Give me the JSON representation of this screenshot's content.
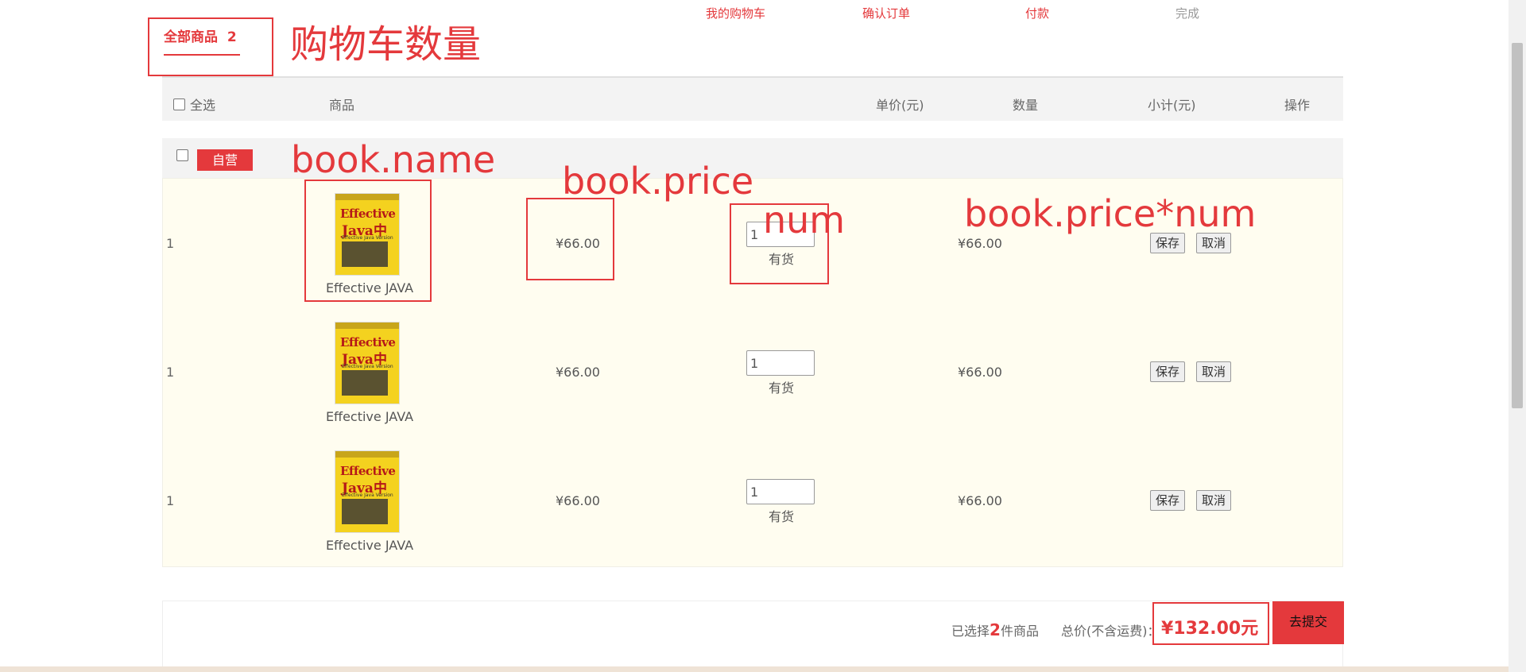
{
  "steps": [
    "我的购物车",
    "确认订单",
    "付款",
    "完成"
  ],
  "tab": {
    "label": "全部商品",
    "count": "2"
  },
  "annotations": {
    "title": "购物车数量",
    "name": "book.name",
    "price": "book.price",
    "num": "num",
    "subtotal": "book.price*num"
  },
  "header": {
    "select_all": "全选",
    "goods": "商品",
    "unit_price": "单价(元)",
    "quantity": "数量",
    "subtotal": "小计(元)",
    "actions": "操作"
  },
  "shop": {
    "tag": "自营"
  },
  "items": [
    {
      "index": "1",
      "name": "Effective JAVA",
      "price": "¥66.00",
      "num": "1",
      "stock": "有货",
      "subtotal": "¥66.00",
      "save": "保存",
      "cancel": "取消"
    },
    {
      "index": "1",
      "name": "Effective JAVA",
      "price": "¥66.00",
      "num": "1",
      "stock": "有货",
      "subtotal": "¥66.00",
      "save": "保存",
      "cancel": "取消"
    },
    {
      "index": "1",
      "name": "Effective JAVA",
      "price": "¥66.00",
      "num": "1",
      "stock": "有货",
      "subtotal": "¥66.00",
      "save": "保存",
      "cancel": "取消"
    }
  ],
  "cover": {
    "line1": "Effective",
    "line2": "Java中文版",
    "line3": "Effective Java Version"
  },
  "footer": {
    "selected_prefix": "已选择",
    "selected_count": "2",
    "selected_suffix": "件商品",
    "total_label": "总价(不含运费)：",
    "total": "¥132.00元",
    "submit": "去提交"
  },
  "colors": {
    "accent": "#e4393c",
    "row_bg": "#fffdf0"
  }
}
